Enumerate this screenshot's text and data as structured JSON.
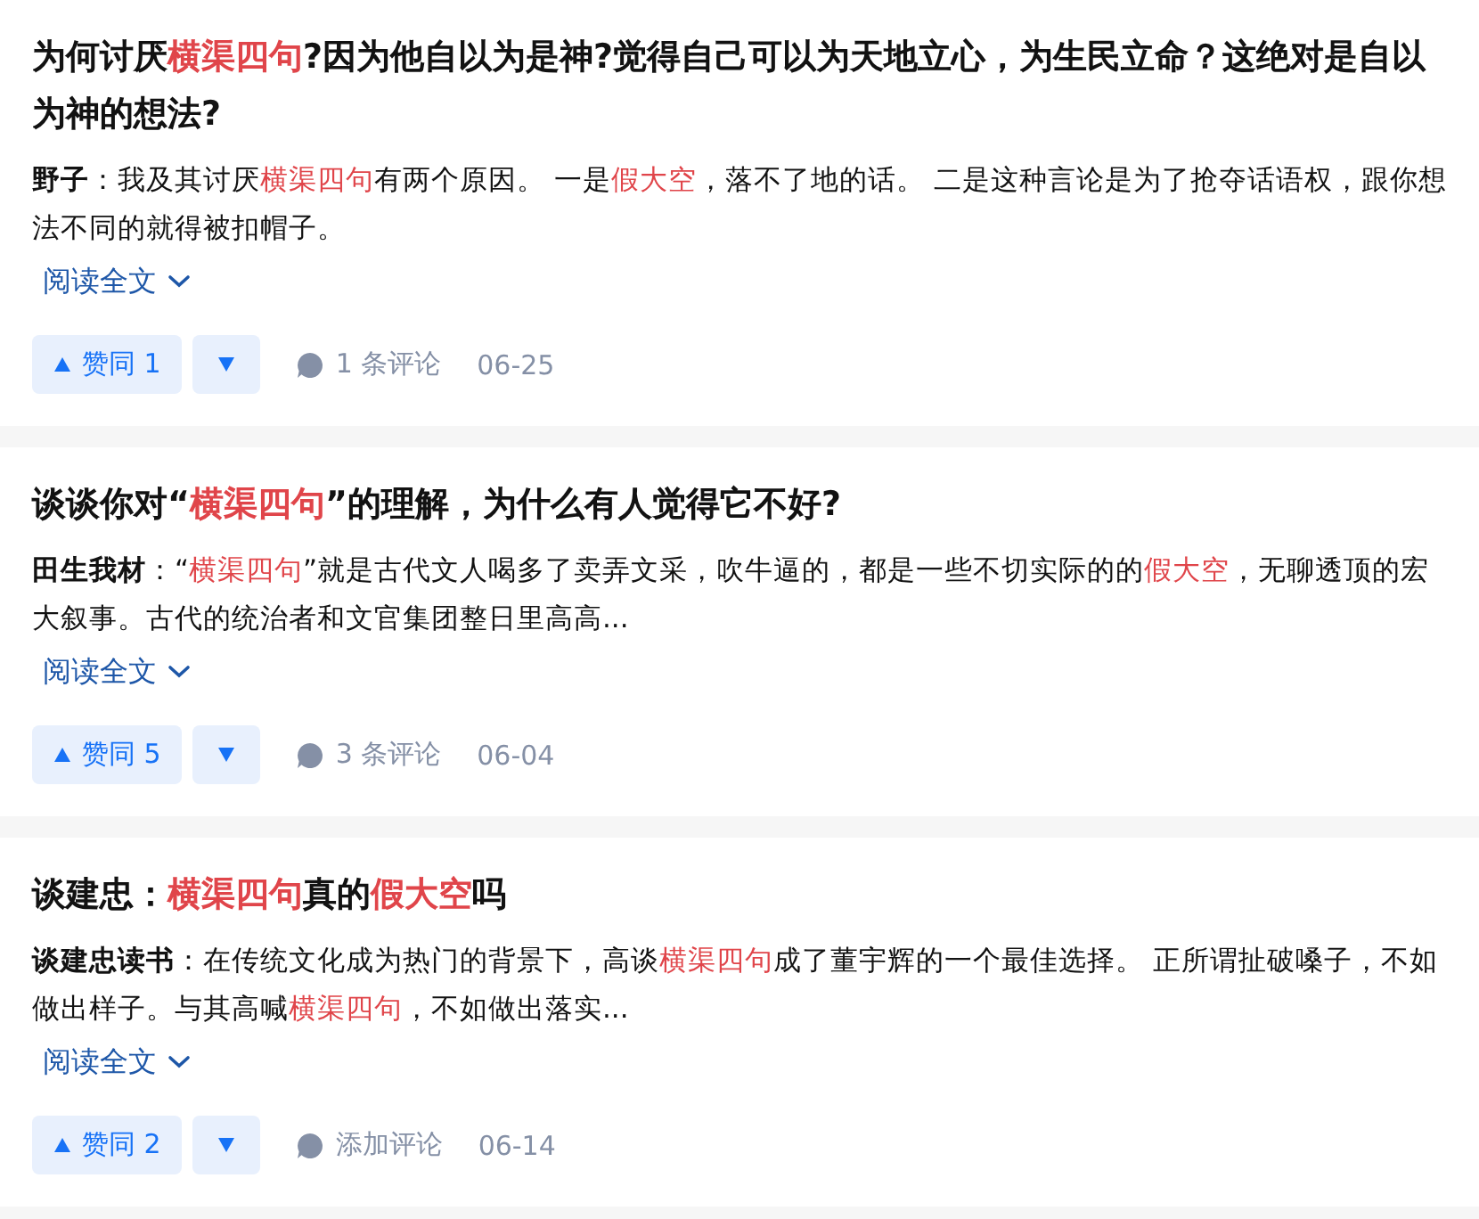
{
  "results": [
    {
      "title": [
        {
          "text": "为何讨厌",
          "highlight": false
        },
        {
          "text": "横渠四句",
          "highlight": true
        },
        {
          "text": "?因为他自以为是神?觉得自己可以为天地立心，为生民立命？这绝对是自以为神的想法?",
          "highlight": false
        }
      ],
      "author": "野子",
      "excerpt": [
        {
          "text": "：我及其讨厌",
          "highlight": false
        },
        {
          "text": "横渠四句",
          "highlight": true
        },
        {
          "text": "有两个原因。 一是",
          "highlight": false
        },
        {
          "text": "假大空",
          "highlight": true
        },
        {
          "text": "，落不了地的话。 二是这种言论是为了抢夺话语权，跟你想法不同的就得被扣帽子。",
          "highlight": false
        }
      ],
      "read_more": "阅读全文",
      "upvote": "赞同 1",
      "comments": "1 条评论",
      "date": "06-25"
    },
    {
      "title": [
        {
          "text": "谈谈你对“",
          "highlight": false
        },
        {
          "text": "横渠四句",
          "highlight": true
        },
        {
          "text": "”的理解，为什么有人觉得它不好?",
          "highlight": false
        }
      ],
      "author": "田生我材",
      "excerpt": [
        {
          "text": "：“",
          "highlight": false
        },
        {
          "text": "横渠四句",
          "highlight": true
        },
        {
          "text": "”就是古代文人喝多了卖弄文采，吹牛逼的，都是一些不切实际的的",
          "highlight": false
        },
        {
          "text": "假大空",
          "highlight": true
        },
        {
          "text": "，无聊透顶的宏大叙事。古代的统治者和文官集团整日里高高...",
          "highlight": false
        }
      ],
      "read_more": "阅读全文",
      "upvote": "赞同 5",
      "comments": "3 条评论",
      "date": "06-04"
    },
    {
      "title": [
        {
          "text": "谈建忠：",
          "highlight": false
        },
        {
          "text": "横渠四句",
          "highlight": true
        },
        {
          "text": "真的",
          "highlight": false
        },
        {
          "text": "假大空",
          "highlight": true
        },
        {
          "text": "吗",
          "highlight": false
        }
      ],
      "author": "谈建忠读书",
      "excerpt": [
        {
          "text": "：在传统文化成为热门的背景下，高谈",
          "highlight": false
        },
        {
          "text": "横渠四句",
          "highlight": true
        },
        {
          "text": "成了董宇辉的一个最佳选择。 正所谓扯破嗓子，不如做出样子。与其高喊",
          "highlight": false
        },
        {
          "text": "横渠四句",
          "highlight": true
        },
        {
          "text": "，不如做出落实...",
          "highlight": false
        }
      ],
      "read_more": "阅读全文",
      "upvote": "赞同 2",
      "comments": "添加评论",
      "date": "06-14"
    }
  ]
}
